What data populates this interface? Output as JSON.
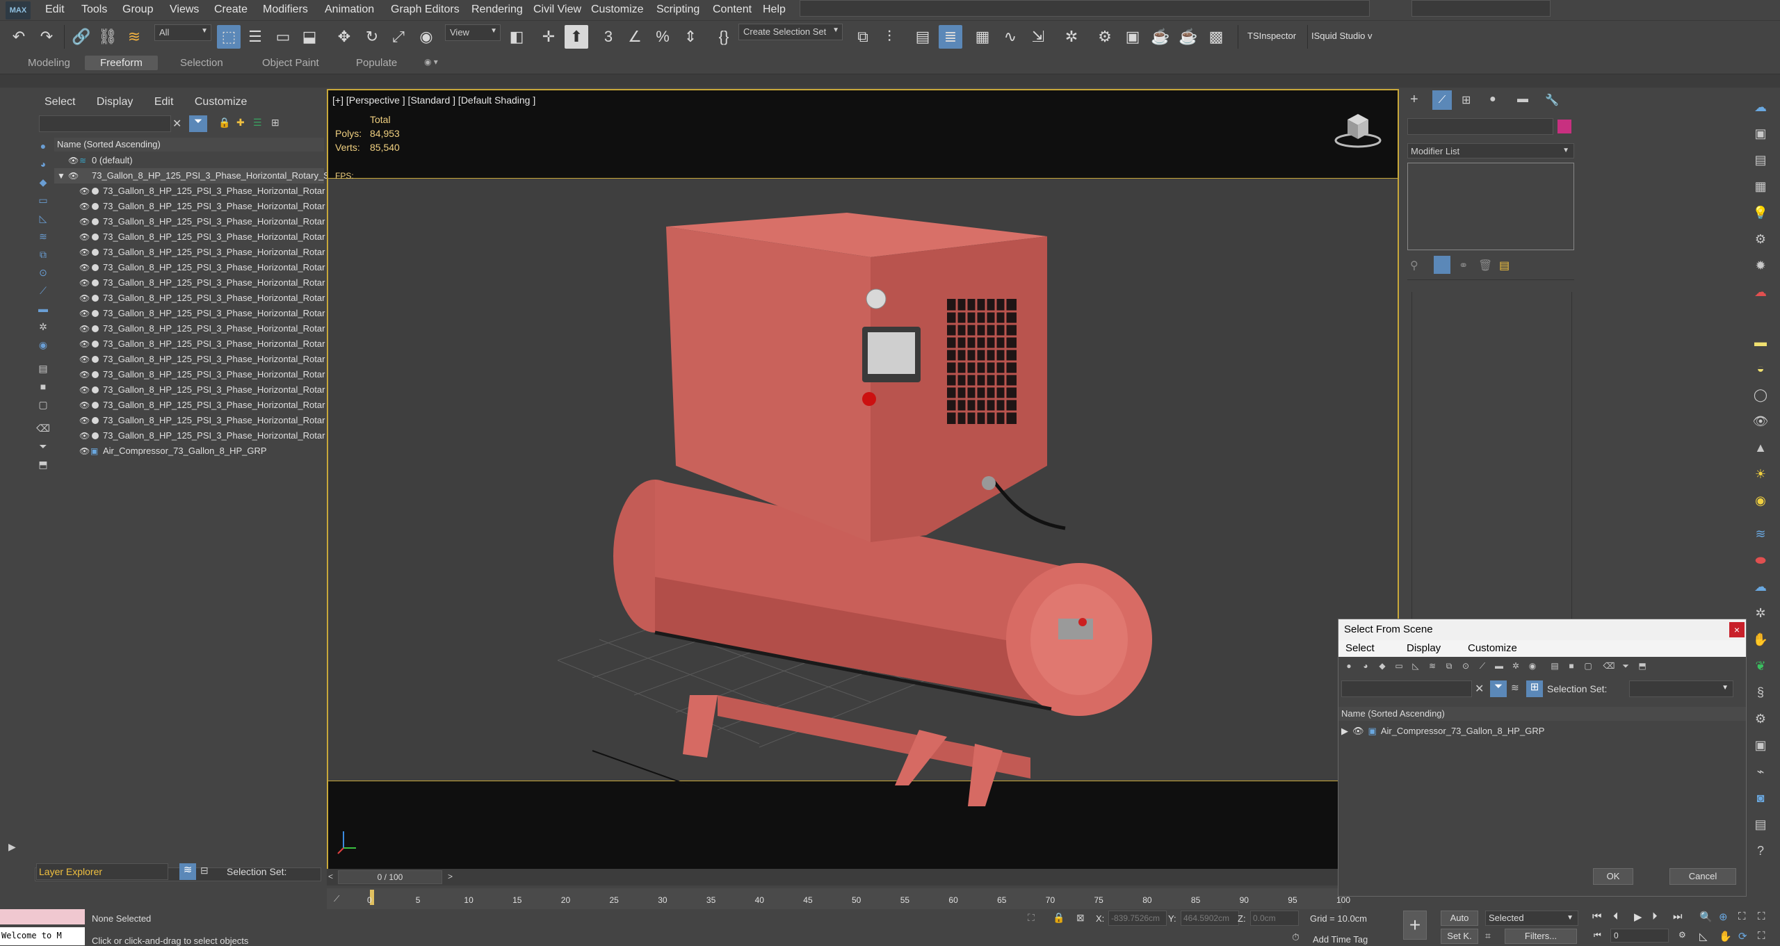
{
  "menu": {
    "logo": "MAX",
    "items": [
      "Edit",
      "Tools",
      "Group",
      "Views",
      "Create",
      "Modifiers",
      "Animation",
      "Graph Editors",
      "Rendering",
      "Civil View",
      "Customize",
      "Scripting",
      "Content",
      "Help"
    ]
  },
  "toolbar": {
    "selection_filter": "All",
    "ref_coord": "View",
    "named_selection": "Create Selection Set",
    "ts_inspector": "TSInspector",
    "isquid": "ISquid Studio v"
  },
  "ribbon": {
    "tabs": [
      "Modeling",
      "Freeform",
      "Selection",
      "Object Paint",
      "Populate"
    ],
    "active": "Freeform"
  },
  "scene_explorer": {
    "menu": [
      "Select",
      "Display",
      "Edit",
      "Customize"
    ],
    "header": "Name (Sorted Ascending)",
    "rows": [
      {
        "label": "0 (default)",
        "level": 0
      },
      {
        "label": "73_Gallon_8_HP_125_PSI_3_Phase_Horizontal_Rotary_S",
        "level": 0
      },
      {
        "label": "73_Gallon_8_HP_125_PSI_3_Phase_Horizontal_Rotar",
        "level": 1
      },
      {
        "label": "73_Gallon_8_HP_125_PSI_3_Phase_Horizontal_Rotar",
        "level": 1
      },
      {
        "label": "73_Gallon_8_HP_125_PSI_3_Phase_Horizontal_Rotar",
        "level": 1
      },
      {
        "label": "73_Gallon_8_HP_125_PSI_3_Phase_Horizontal_Rotar",
        "level": 1
      },
      {
        "label": "73_Gallon_8_HP_125_PSI_3_Phase_Horizontal_Rotar",
        "level": 1
      },
      {
        "label": "73_Gallon_8_HP_125_PSI_3_Phase_Horizontal_Rotar",
        "level": 1
      },
      {
        "label": "73_Gallon_8_HP_125_PSI_3_Phase_Horizontal_Rotar",
        "level": 1
      },
      {
        "label": "73_Gallon_8_HP_125_PSI_3_Phase_Horizontal_Rotar",
        "level": 1
      },
      {
        "label": "73_Gallon_8_HP_125_PSI_3_Phase_Horizontal_Rotar",
        "level": 1
      },
      {
        "label": "73_Gallon_8_HP_125_PSI_3_Phase_Horizontal_Rotar",
        "level": 1
      },
      {
        "label": "73_Gallon_8_HP_125_PSI_3_Phase_Horizontal_Rotar",
        "level": 1
      },
      {
        "label": "73_Gallon_8_HP_125_PSI_3_Phase_Horizontal_Rotar",
        "level": 1
      },
      {
        "label": "73_Gallon_8_HP_125_PSI_3_Phase_Horizontal_Rotar",
        "level": 1
      },
      {
        "label": "73_Gallon_8_HP_125_PSI_3_Phase_Horizontal_Rotar",
        "level": 1
      },
      {
        "label": "73_Gallon_8_HP_125_PSI_3_Phase_Horizontal_Rotar",
        "level": 1
      },
      {
        "label": "73_Gallon_8_HP_125_PSI_3_Phase_Horizontal_Rotar",
        "level": 1
      },
      {
        "label": "73_Gallon_8_HP_125_PSI_3_Phase_Horizontal_Rotar",
        "level": 1
      },
      {
        "label": "Air_Compressor_73_Gallon_8_HP_GRP",
        "level": 1
      }
    ],
    "layer_explorer": "Layer Explorer",
    "selection_set": "Selection Set:"
  },
  "viewport": {
    "label": "[+] [Perspective ] [Standard ] [Default Shading ]",
    "stats_title": "Total",
    "polys_label": "Polys:",
    "polys": "84,953",
    "verts_label": "Verts:",
    "verts": "85,540",
    "fps": "FPS:"
  },
  "command_panel": {
    "modifier_list": "Modifier List",
    "color_swatch": "#c83080"
  },
  "dialog": {
    "title": "Select From Scene",
    "close": "×",
    "menu": [
      "Select",
      "Display",
      "Customize"
    ],
    "selection_set_label": "Selection Set:",
    "header": "Name (Sorted Ascending)",
    "item": "Air_Compressor_73_Gallon_8_HP_GRP",
    "ok": "OK",
    "cancel": "Cancel"
  },
  "timeline": {
    "slider": "0 / 100",
    "ticks": [
      "0",
      "5",
      "10",
      "15",
      "20",
      "25",
      "30",
      "35",
      "40",
      "45",
      "50",
      "55",
      "60",
      "65",
      "70",
      "75",
      "80",
      "85",
      "90",
      "95",
      "100"
    ]
  },
  "status": {
    "welcome": "Welcome to M",
    "none_selected": "None Selected",
    "prompt": "Click or click-and-drag to select objects",
    "x_label": "X:",
    "x_value": "-839.7526cm",
    "y_label": "Y:",
    "y_value": "464.5902cm",
    "z_label": "Z:",
    "z_value": "0.0cm",
    "grid": "Grid = 10.0cm",
    "add_time_tag": "Add Time Tag",
    "auto": "Auto",
    "selected": "Selected",
    "set_key": "Set K.",
    "filters": "Filters...",
    "frame": "0"
  },
  "colors": {
    "viewport_border": "#c8a83a",
    "model": "#c8605a",
    "accent": "#5b88b8"
  }
}
